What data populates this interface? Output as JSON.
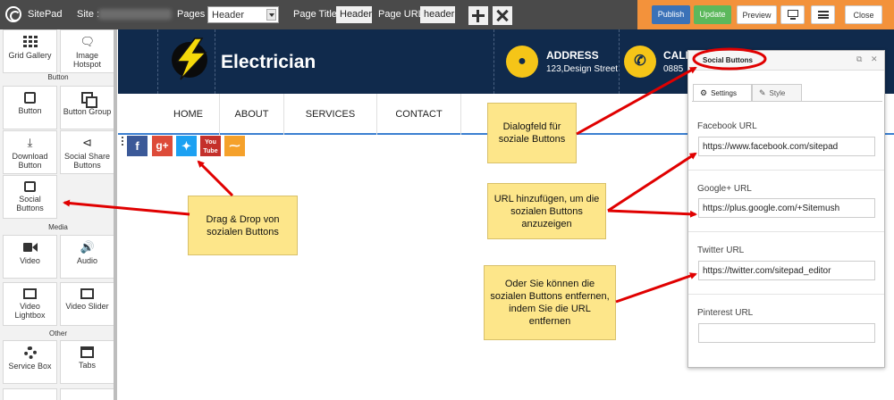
{
  "topbar": {
    "app_name": "SitePad",
    "site_label": "Site :",
    "pages_label": "Pages :",
    "pages_value": "Header",
    "page_title_label": "Page Title:",
    "page_title_value": "Header",
    "page_url_label": "Page URL:",
    "page_url_value": "header",
    "publish": "Publish",
    "update": "Update",
    "preview": "Preview",
    "close": "Close",
    "colors": {
      "bar": "#4a4a4a",
      "accent": "#f3923b",
      "publish": "#3b72b8",
      "update": "#5cb85c"
    }
  },
  "left_panel": {
    "tiles_top": [
      {
        "label": "Grid Gallery",
        "icon": "grid-icon"
      },
      {
        "label": "Image Hotspot",
        "icon": "comment-icon"
      }
    ],
    "cat_button": "Button",
    "tiles_button": [
      {
        "label": "Button",
        "icon": "square-icon"
      },
      {
        "label": "Button Group",
        "icon": "group-icon"
      },
      {
        "label": "Download Button",
        "icon": "download-icon"
      },
      {
        "label": "Social Share Buttons",
        "icon": "share-icon"
      },
      {
        "label": "Social Buttons",
        "icon": "social-icon"
      }
    ],
    "cat_media": "Media",
    "tiles_media": [
      {
        "label": "Video",
        "icon": "video-icon"
      },
      {
        "label": "Audio",
        "icon": "speaker-icon"
      },
      {
        "label": "Video Lightbox",
        "icon": "film-icon"
      },
      {
        "label": "Video Slider",
        "icon": "play-icon"
      }
    ],
    "cat_other": "Other",
    "tiles_other": [
      {
        "label": "Service Box",
        "icon": "gear-icon"
      },
      {
        "label": "Tabs",
        "icon": "tabs-icon"
      }
    ]
  },
  "website": {
    "brand": "Electrician",
    "address_title": "ADDRESS",
    "address_value": "123,Design Street",
    "call_title": "CALL",
    "call_value": "0885",
    "nav": [
      "HOME",
      "ABOUT",
      "SERVICES",
      "CONTACT"
    ],
    "social": [
      {
        "glyph": "f",
        "color": "#3b5998"
      },
      {
        "glyph": "g+",
        "color": "#dd4b39"
      },
      {
        "glyph": "t",
        "color": "#1da1f2"
      },
      {
        "glyph": "You",
        "color": "#c4302b"
      },
      {
        "glyph": "rss",
        "color": "#f5a12b"
      }
    ],
    "colors": {
      "header": "#102a4c",
      "accent": "#f5c518"
    }
  },
  "notes": {
    "dialog": "Dialogfeld für soziale Buttons",
    "drag": "Drag & Drop von sozialen Buttons",
    "add_url": "URL hinzufügen, um die sozialen Buttons anzuzeigen",
    "remove": "Oder Sie können die sozialen Buttons entfernen, indem Sie die URL entfernen"
  },
  "dialog": {
    "title": "Social Buttons",
    "tab_settings": "Settings",
    "tab_style": "Style",
    "facebook_label": "Facebook URL",
    "facebook_value": "https://www.facebook.com/sitepad",
    "google_label": "Google+ URL",
    "google_value": "https://plus.google.com/+Sitemush",
    "twitter_label": "Twitter URL",
    "twitter_value": "https://twitter.com/sitepad_editor",
    "pinterest_label": "Pinterest URL",
    "pinterest_value": ""
  }
}
